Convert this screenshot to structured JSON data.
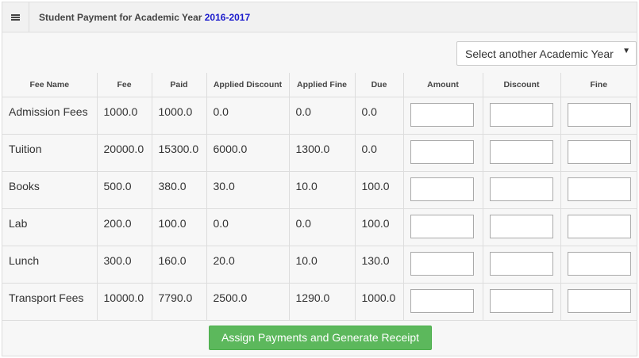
{
  "header": {
    "title_prefix": "Student Payment for Academic Year",
    "academic_year": "2016-2017",
    "year_color": "#1a1acc"
  },
  "year_select": {
    "selected": "Select another Academic Year"
  },
  "table": {
    "columns": {
      "fee_name": "Fee Name",
      "fee": "Fee",
      "paid": "Paid",
      "applied_discount": "Applied Discount",
      "applied_fine": "Applied Fine",
      "due": "Due",
      "amount": "Amount",
      "discount": "Discount",
      "fine": "Fine"
    },
    "rows": [
      {
        "name": "Admission Fees",
        "fee": "1000.0",
        "paid": "1000.0",
        "applied_discount": "0.0",
        "applied_fine": "0.0",
        "due": "0.0",
        "amount": "",
        "discount": "",
        "fine": ""
      },
      {
        "name": "Tuition",
        "fee": "20000.0",
        "paid": "15300.0",
        "applied_discount": "6000.0",
        "applied_fine": "1300.0",
        "due": "0.0",
        "amount": "",
        "discount": "",
        "fine": ""
      },
      {
        "name": "Books",
        "fee": "500.0",
        "paid": "380.0",
        "applied_discount": "30.0",
        "applied_fine": "10.0",
        "due": "100.0",
        "amount": "",
        "discount": "",
        "fine": ""
      },
      {
        "name": "Lab",
        "fee": "200.0",
        "paid": "100.0",
        "applied_discount": "0.0",
        "applied_fine": "0.0",
        "due": "100.0",
        "amount": "",
        "discount": "",
        "fine": ""
      },
      {
        "name": "Lunch",
        "fee": "300.0",
        "paid": "160.0",
        "applied_discount": "20.0",
        "applied_fine": "10.0",
        "due": "130.0",
        "amount": "",
        "discount": "",
        "fine": ""
      },
      {
        "name": "Transport Fees",
        "fee": "10000.0",
        "paid": "7790.0",
        "applied_discount": "2500.0",
        "applied_fine": "1290.0",
        "due": "1000.0",
        "amount": "",
        "discount": "",
        "fine": ""
      }
    ]
  },
  "actions": {
    "submit_label": "Assign Payments and Generate Receipt",
    "submit_color": "#5cb85c"
  },
  "icons": {
    "menu": "hamburger-menu-icon",
    "caret": "caret-down-icon"
  }
}
